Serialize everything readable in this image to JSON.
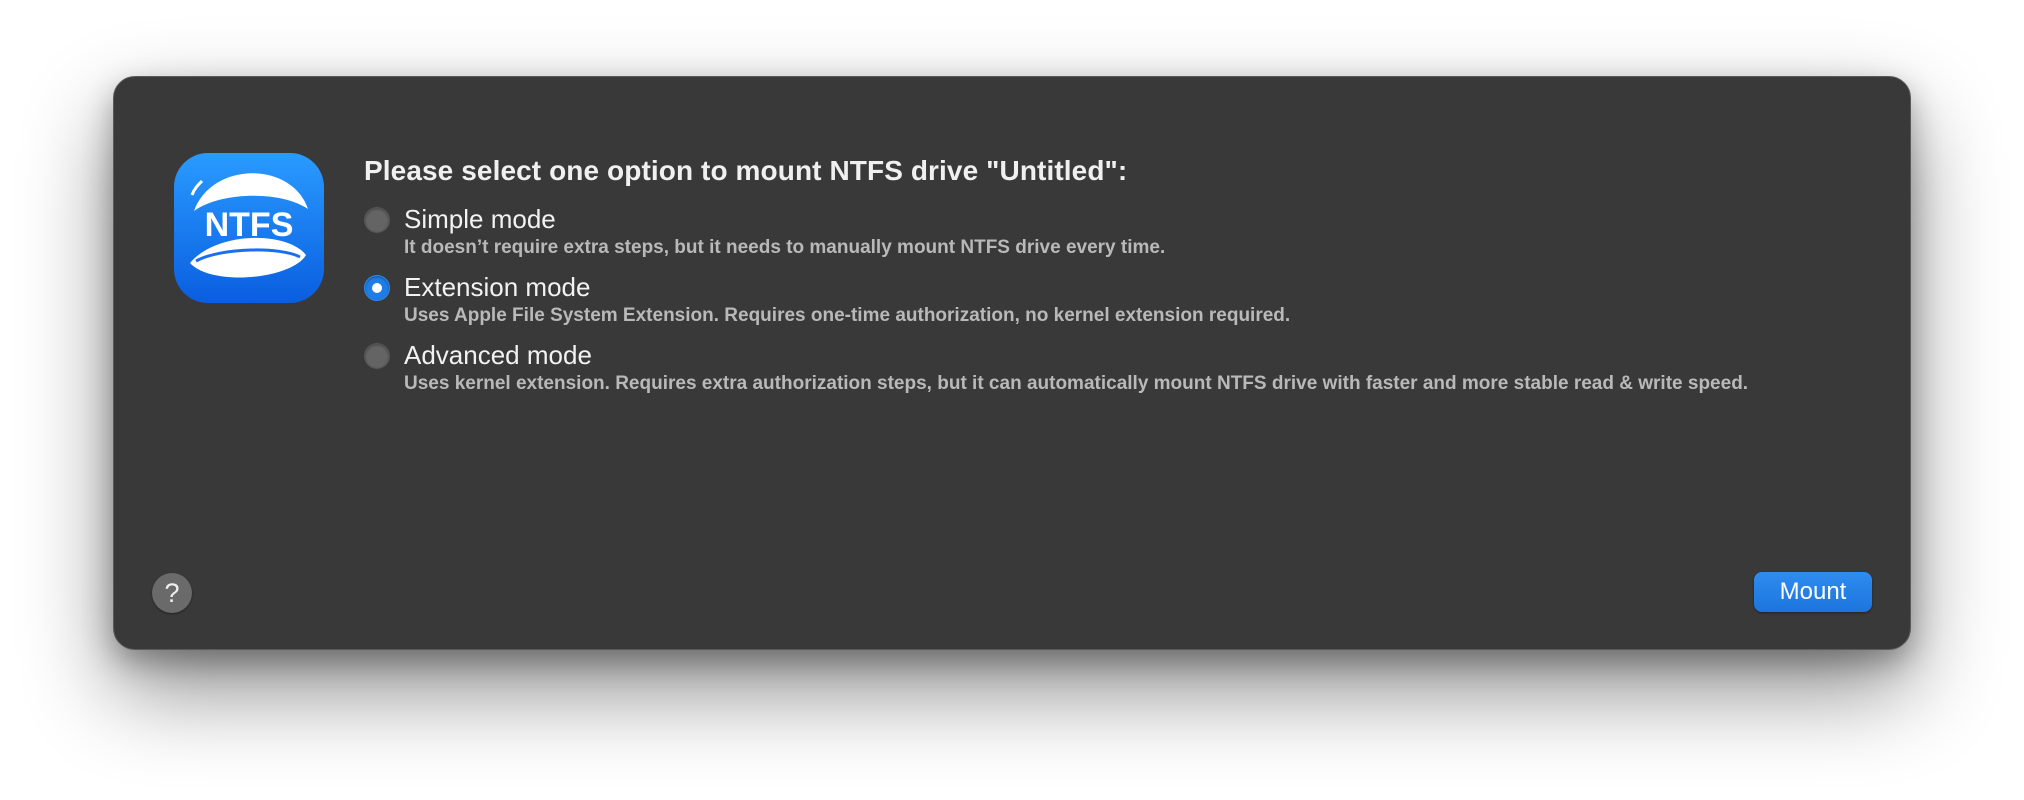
{
  "dialog": {
    "heading": "Please select one option to mount NTFS drive \"Untitled\":",
    "app_icon": {
      "icon": "ntfs-app-icon",
      "text": "NTFS",
      "color": "#1a6ff0"
    },
    "options": [
      {
        "label": "Simple mode",
        "description": "It doesn’t require extra steps, but it needs to manually mount NTFS drive every time.",
        "selected": false
      },
      {
        "label": "Extension mode",
        "description": "Uses Apple File System Extension. Requires one-time authorization, no kernel extension required.",
        "selected": true
      },
      {
        "label": "Advanced mode",
        "description": "Uses kernel extension. Requires extra authorization steps, but it can automatically mount NTFS drive with faster and more stable read & write speed.",
        "selected": false
      }
    ],
    "help_button": {
      "label": "?"
    },
    "mount_button": {
      "label": "Mount",
      "color": "#1e7de6"
    }
  }
}
